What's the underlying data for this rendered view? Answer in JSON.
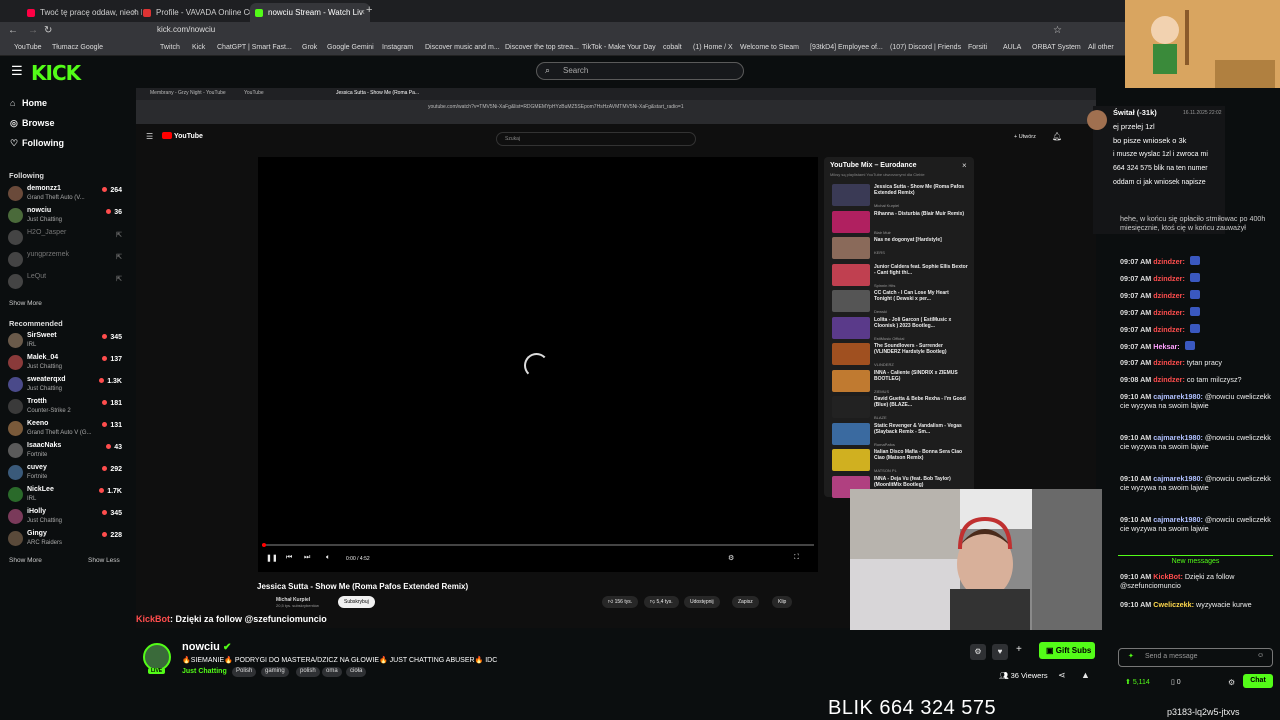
{
  "browser": {
    "tabs": [
      {
        "label": "Twoć tę pracę oddaw, niech bu"
      },
      {
        "label": "Profile - VAVADA Online Casino"
      },
      {
        "label": "nowciu Stream - Watch Liv"
      }
    ],
    "url": "kick.com/nowciu",
    "bookmarks": [
      "YouTube",
      "Tłumacz Google",
      "Twitch",
      "Kick",
      "ChatGPT | Smart Fast...",
      "Grok",
      "Google Gemini",
      "Instagram",
      "Discover music and m...",
      "Discover the top strea...",
      "TikTok - Make Your Day",
      "cobalt",
      "(1) Home / X",
      "Welcome to Steam",
      "[93tkD4] Employee of...",
      "(107) Discord | Friends",
      "Forsiti",
      "AULA",
      "ORBAT System",
      "All other"
    ]
  },
  "kick": {
    "logo": "KICK",
    "search_placeholder": "Search",
    "nav": [
      {
        "icon": "⌂",
        "label": "Home"
      },
      {
        "icon": "◎",
        "label": "Browse"
      },
      {
        "icon": "♡",
        "label": "Following"
      }
    ],
    "following_title": "Following",
    "following": [
      {
        "name": "demonzz1",
        "game": "Grand Theft Auto (V...",
        "viewers": "264",
        "online": true,
        "color": "#6a4a3a"
      },
      {
        "name": "nowciu",
        "game": "Just Chatting",
        "viewers": "36",
        "online": true,
        "color": "#4a6a3a"
      },
      {
        "name": "H2O_Jasper",
        "game": "",
        "viewers": "",
        "online": false,
        "color": "#444"
      },
      {
        "name": "yungprzemek",
        "game": "",
        "viewers": "",
        "online": false,
        "color": "#444"
      },
      {
        "name": "LeQut",
        "game": "",
        "viewers": "",
        "online": false,
        "color": "#444"
      }
    ],
    "show_more": "Show More",
    "recommended_title": "Recommended",
    "recommended": [
      {
        "name": "SirSweet",
        "game": "IRL",
        "viewers": "345",
        "color": "#6a5a4a"
      },
      {
        "name": "Malek_04",
        "game": "Just Chatting",
        "viewers": "137",
        "color": "#8a3a3a"
      },
      {
        "name": "sweaterqxd",
        "game": "Just Chatting",
        "viewers": "1.3K",
        "color": "#4a4a8a"
      },
      {
        "name": "Trotth",
        "game": "Counter-Strike 2",
        "viewers": "181",
        "color": "#3a3a3a"
      },
      {
        "name": "Keeno",
        "game": "Grand Theft Auto V (G...",
        "viewers": "131",
        "color": "#7a5a3a"
      },
      {
        "name": "IsaacNaks",
        "game": "Fortnite",
        "viewers": "43",
        "color": "#5a5a5a"
      },
      {
        "name": "cuvey",
        "game": "Fortnite",
        "viewers": "292",
        "color": "#3a5a7a"
      },
      {
        "name": "NickLee",
        "game": "IRL",
        "viewers": "1.7K",
        "color": "#2a6a2a"
      },
      {
        "name": "iHolly",
        "game": "Just Chatting",
        "viewers": "345",
        "color": "#7a3a5a"
      },
      {
        "name": "Gingy",
        "game": "ARC Raiders",
        "viewers": "228",
        "color": "#5a4a3a"
      }
    ],
    "show_less": "Show Less"
  },
  "youtube": {
    "inner_tabs": [
      "Membrany - Grzy Night - YouTube",
      "YouTube",
      "Jessica Sutta - Show Me (Roma Pa..."
    ],
    "inner_url": "youtube.com/watch?v=TMV5Ni-XaFg&list=RDGMEMYpHYzBuMZ5SEpom7HsHzAVMTMV5Ni-XaFg&start_radio=1",
    "logo": "YouTube",
    "search_placeholder": "Szukaj",
    "create_label": "+ Utwórz",
    "time": "0:00 / 4:52",
    "video_title": "Jessica Sutta - Show Me (Roma Pafos Extended Remix)",
    "channel": "Michał Kurpiel",
    "subscribers": "20,5 tys. subskrybentów",
    "subscribe": "Subskrybuj",
    "likes": "156 tys.",
    "dislikes": "5,4 tys.",
    "share": "Udostępnij",
    "save": "Zapisz",
    "clip": "Klip",
    "mix_title": "YouTube Mix – Eurodance",
    "mix_sub": "Miksy są playlistami YouTube utworzonymi dla Ciebie",
    "mix": [
      {
        "title": "Jessica Sutta - Show Me (Roma Pafos Extended Remix)",
        "author": "Michał Kurpiel",
        "color": "#3a3a55"
      },
      {
        "title": "Rihanna - Disturbia (Blair Muir Remix)",
        "author": "Blair Muir",
        "color": "#b02060"
      },
      {
        "title": "Nas ne dogonyat [Hardstyle]",
        "author": "KERS",
        "color": "#8a6a5a"
      },
      {
        "title": "Junior Caldera feat. Sophie Ellis Bextor - Cant fight thi...",
        "author": "Spinnin Hits",
        "color": "#c04050"
      },
      {
        "title": "CC Catch - I Can Lose My Heart Tonight ( Dewski x per...",
        "author": "Dewski",
        "color": "#555"
      },
      {
        "title": "Lolita - Joli Garcon ( EstiMusic x Cloonisk ) 2023 Bootleg...",
        "author": "EstiMusic Official",
        "color": "#5a3a8a"
      },
      {
        "title": "The Soundlovers - Surrender (VLINDERZ Hardstyle Bootleg)",
        "author": "VLINDERZ",
        "color": "#a05020"
      },
      {
        "title": "INNA - Caliente (SINDRIX x ZIEMUS BOOTLEG)",
        "author": "ZIEMUS",
        "color": "#c07a30"
      },
      {
        "title": "David Guetta & Bebe Rexha - I'm Good (Blue) (BLAZE...",
        "author": "BLAZE",
        "color": "#222"
      },
      {
        "title": "Static Revenger & Vandalism - Vegas (Slayback Remix - Sm...",
        "author": "RomaPafos",
        "color": "#3a6aa0"
      },
      {
        "title": "Italian Disco Mafia - Bonna Sera Ciao Ciao (Matson Remix)",
        "author": "MATSON PL",
        "color": "#d0b020"
      },
      {
        "title": "INNA - Deja Vu (feat. Bob Taylor) (MoonlitMix Bootleg)",
        "author": "MoonlitMix",
        "color": "#b04080"
      }
    ]
  },
  "chat": {
    "pinned": {
      "user": "Świtał (-31k)",
      "date": "16.11.2025 22:02",
      "lines": [
        "ej przelej 1zl",
        "bo pisze wniosek o 3k",
        "i musze wyslac 1zl i zwroca mi",
        "664 324 575 blik na ten numer",
        "oddam ci jak wniosek napisze"
      ]
    },
    "top_text": "hehe, w końcu się opłaciło stmiłowac po 400h miesięcznie, ktoś cię w końcu zauważył",
    "messages": [
      {
        "time": "09:07 AM",
        "user": "dzindzer:",
        "text": "",
        "color": "#ff4d4d"
      },
      {
        "time": "09:07 AM",
        "user": "dzindzer:",
        "text": "",
        "color": "#ff4d4d"
      },
      {
        "time": "09:07 AM",
        "user": "dzindzer:",
        "text": "",
        "color": "#ff4d4d"
      },
      {
        "time": "09:07 AM",
        "user": "dzindzer:",
        "text": "",
        "color": "#ff4d4d"
      },
      {
        "time": "09:07 AM",
        "user": "dzindzer:",
        "text": "",
        "color": "#ff4d4d"
      },
      {
        "time": "09:07 AM",
        "user": "Heksar:",
        "text": "",
        "color": "#ffa0ff"
      },
      {
        "time": "09:07 AM",
        "user": "dzindzer:",
        "text": "tytan pracy",
        "color": "#ff4d4d"
      },
      {
        "time": "09:08 AM",
        "user": "dzindzer:",
        "text": "co tam milczysz?",
        "color": "#ff4d4d"
      },
      {
        "time": "09:10 AM",
        "user": "cajmarek1980:",
        "text": "@nowciu cweliczekk cie wyzywa na swoim lajwie",
        "color": "#b0c0ff"
      },
      {
        "time": "09:10 AM",
        "user": "cajmarek1980:",
        "text": "@nowciu cweliczekk cie wyzywa na swoim lajwie",
        "color": "#b0c0ff"
      },
      {
        "time": "09:10 AM",
        "user": "cajmarek1980:",
        "text": "@nowciu cweliczekk cie wyzywa na swoim lajwie",
        "color": "#b0c0ff"
      },
      {
        "time": "09:10 AM",
        "user": "cajmarek1980:",
        "text": "@nowciu cweliczekk cie wyzywa na swoim lajwie",
        "color": "#b0c0ff"
      }
    ],
    "new_messages": "New messages",
    "after": [
      {
        "time": "09:10 AM",
        "user": "KickBot:",
        "text": "Dzięki za follow @szefunciomuncio",
        "color": "#ff4d4d"
      },
      {
        "time": "09:10 AM",
        "user": "Cweliczekk:",
        "text": "wyzywacie kurwe",
        "color": "#ffd84d"
      }
    ],
    "input_placeholder": "Send a message",
    "points": "5,114",
    "zero": "0",
    "chat_button": "Chat"
  },
  "stream": {
    "pinned_msg_user": "KickBot",
    "pinned_msg_text": ": Dzięki za follow @szefunciomuncio",
    "streamer": "nowciu",
    "title": "🔥SIEMANIE🔥 PODRYGI DO MASTERA/DZICZ NA GŁOWIE🔥 JUST CHATTING ABUSER🔥 IDC",
    "category": "Just Chatting",
    "tags": [
      "Polish",
      "gaming",
      "polish",
      "oma",
      "cioła"
    ],
    "gift_subs": "Gift Subs",
    "viewers": "36 Viewers",
    "live": "LIVE"
  },
  "overlay": {
    "blik": "BLIK 664 324 575",
    "host": "p3183-lq2w5-jtxvs"
  }
}
